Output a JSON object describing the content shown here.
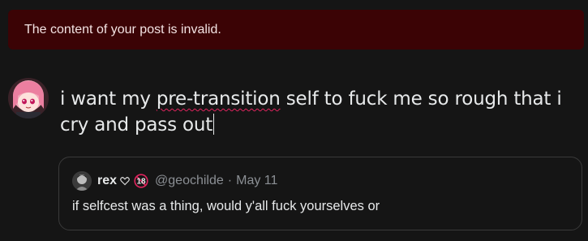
{
  "error": {
    "message": "The content of your post is invalid."
  },
  "composer": {
    "text_before": "i want my ",
    "misspelled_word": "pre-transition",
    "text_after": " self to fuck me so rough that i cry and pass out"
  },
  "quote": {
    "author_name": "rex",
    "heart_icon": "heart-icon",
    "badge_icon": "18-plus-icon",
    "handle": "@geochilde",
    "separator": "·",
    "date": "May 11",
    "text": "if selfcest was a thing, would y'all fuck yourselves or"
  },
  "colors": {
    "error_bg": "#3b0305",
    "background": "#151515",
    "spellcheck": "#e0245e",
    "secondary_text": "#8b8f94"
  }
}
